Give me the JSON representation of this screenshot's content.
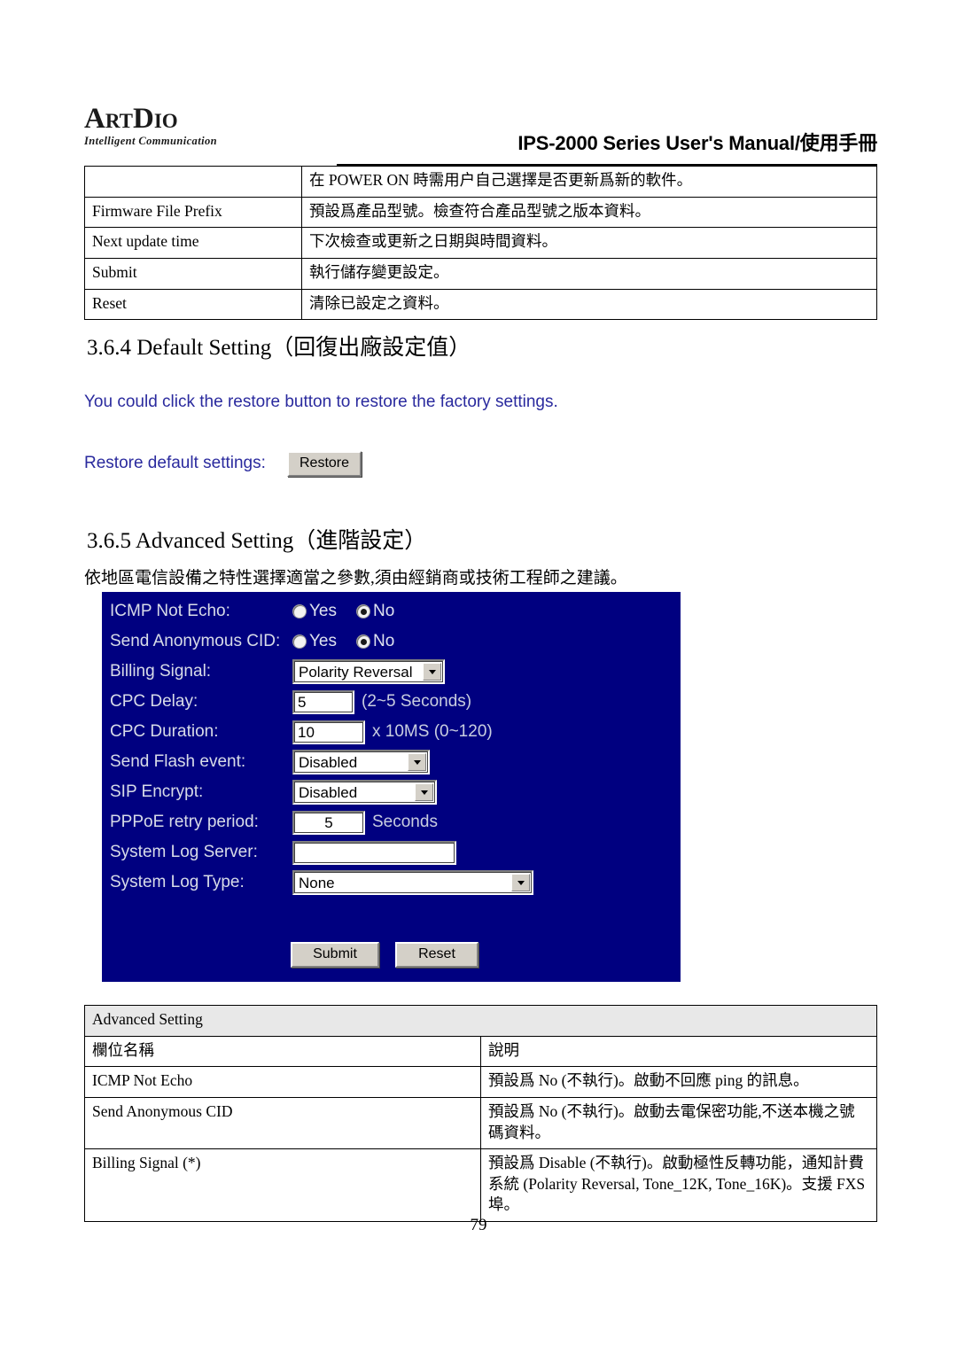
{
  "header": {
    "logo_main_parts": [
      "A",
      "RT",
      "D",
      "IO"
    ],
    "logo_text": "ArtDio",
    "logo_tagline": "Intelligent Communication",
    "manual_title": "IPS-2000 Series User's Manual/使用手冊"
  },
  "top_table": {
    "rows": [
      {
        "field": "",
        "desc": "在 POWER ON 時需用户自己選擇是否更新爲新的軟件。"
      },
      {
        "field": "Firmware File Prefix",
        "desc": "預設爲產品型號。檢查符合產品型號之版本資料。"
      },
      {
        "field": "Next update time",
        "desc": "下次檢查或更新之日期與時間資料。"
      },
      {
        "field": "Submit",
        "desc": "執行儲存變更設定。"
      },
      {
        "field": "Reset",
        "desc": "清除已設定之資料。"
      }
    ]
  },
  "section_364": {
    "heading": "3.6.4 Default Setting（回復出廠設定值）",
    "info_text": "You could click the restore button to restore the factory settings.",
    "restore_label": "Restore default settings:",
    "restore_button": "Restore"
  },
  "section_365": {
    "heading": "3.6.5 Advanced Setting（進階設定）",
    "description": "依地區電信設備之特性選擇適當之參數,須由經銷商或技術工程師之建議。"
  },
  "advanced_form": {
    "panel_bg_color": "#000080",
    "icmp_not_echo": {
      "label": "ICMP Not Echo:",
      "yes_label": "Yes",
      "no_label": "No",
      "selected": "No"
    },
    "send_anonymous_cid": {
      "label": "Send Anonymous CID:",
      "yes_label": "Yes",
      "no_label": "No",
      "selected": "No"
    },
    "billing_signal": {
      "label": "Billing Signal:",
      "value": "Polarity Reversal"
    },
    "cpc_delay": {
      "label": "CPC Delay:",
      "value": "5",
      "hint": "(2~5 Seconds)"
    },
    "cpc_duration": {
      "label": "CPC Duration:",
      "value": "10",
      "hint": "x 10MS (0~120)"
    },
    "send_flash_event": {
      "label": "Send Flash event:",
      "value": "Disabled"
    },
    "sip_encrypt": {
      "label": "SIP Encrypt:",
      "value": "Disabled"
    },
    "pppoe_retry_period": {
      "label": "PPPoE retry period:",
      "value": "5",
      "hint": "Seconds"
    },
    "system_log_server": {
      "label": "System Log Server:",
      "value": ""
    },
    "system_log_type": {
      "label": "System Log Type:",
      "value": "None"
    },
    "submit_button": "Submit",
    "reset_button": "Reset"
  },
  "bottom_table": {
    "title": "Advanced Setting",
    "col_headers": [
      "欄位名稱",
      "說明"
    ],
    "rows": [
      {
        "field": "ICMP Not Echo",
        "desc": "預設爲 No (不執行)。啟動不回應 ping 的訊息。"
      },
      {
        "field": "Send Anonymous CID",
        "desc": "預設爲 No (不執行)。啟動去電保密功能,不送本機之號碼資料。"
      },
      {
        "field": "Billing Signal (*)",
        "desc": "預設爲 Disable (不執行)。啟動極性反轉功能，通知計費系統 (Polarity Reversal, Tone_12K, Tone_16K)。支援 FXS 埠。"
      }
    ]
  },
  "footer": {
    "page_number": "79"
  }
}
